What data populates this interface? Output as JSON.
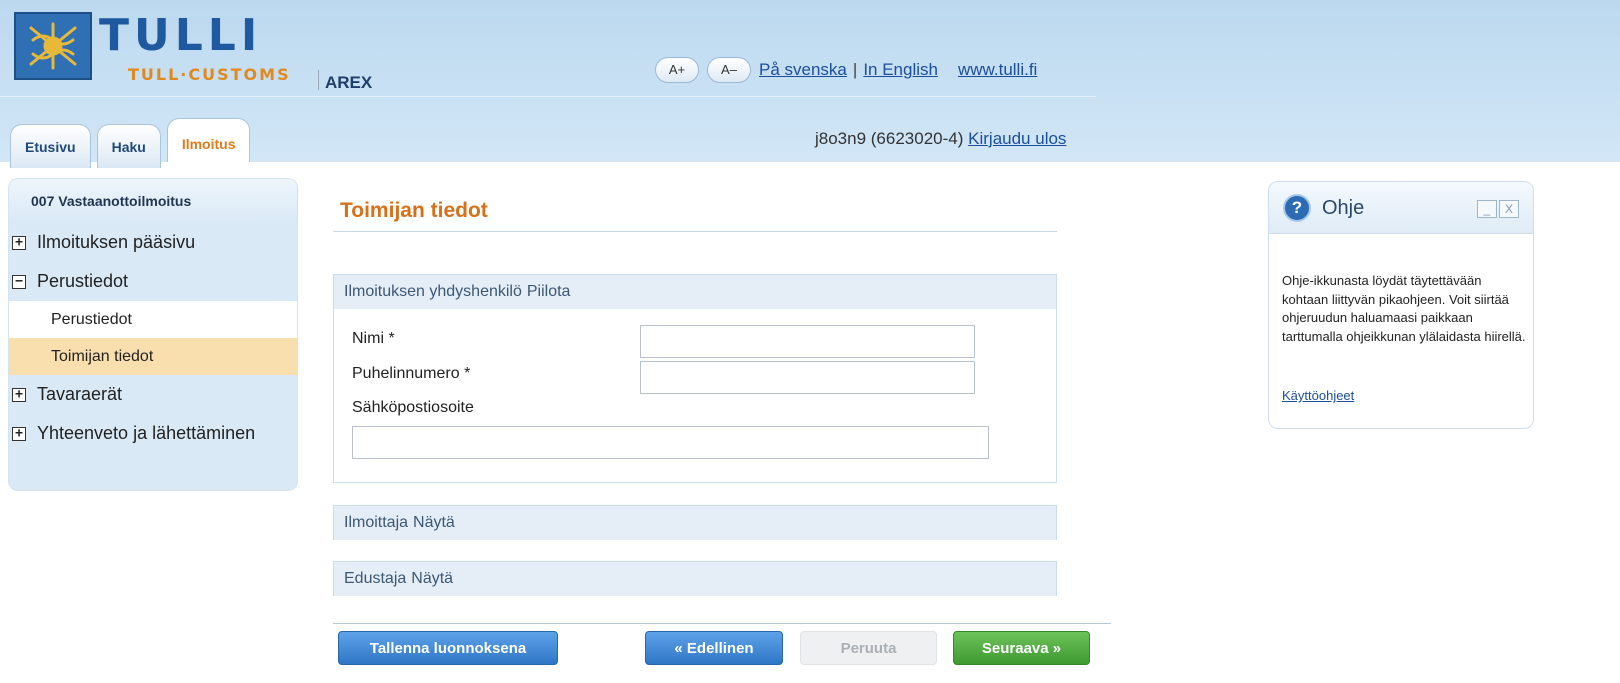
{
  "header": {
    "brand": "TULLI",
    "brand_sub": "TULL·CUSTOMS",
    "app_name": "AREX",
    "font_increase": "A+",
    "font_decrease": "A–",
    "lang_sv": "På svenska",
    "separator": "|",
    "lang_en": "In English",
    "site_link": "www.tulli.fi",
    "user_id": "j8o3n9 (6623020-4)",
    "logout": "Kirjaudu ulos",
    "colors": {
      "brand_blue": "#1f5aa0",
      "brand_orange": "#e08a1e",
      "header_bg": "#c9e1f4"
    }
  },
  "tabs": [
    {
      "label": "Etusivu",
      "active": false
    },
    {
      "label": "Haku",
      "active": false
    },
    {
      "label": "Ilmoitus",
      "active": true
    }
  ],
  "sidebar": {
    "title": "007 Vastaanottoilmoitus",
    "items": [
      {
        "label": "Ilmoituksen pääsivu",
        "expander": "+"
      },
      {
        "label": "Perustiedot",
        "expander": "−"
      },
      {
        "label": "Tavaraerät",
        "expander": "+"
      },
      {
        "label": "Yhteenveto ja lähettäminen",
        "expander": "+"
      }
    ],
    "subitems": [
      {
        "label": "Perustiedot",
        "selected": false
      },
      {
        "label": "Toimijan tiedot",
        "selected": true
      }
    ]
  },
  "main": {
    "section_title": "Toimijan tiedot",
    "contact_panel": {
      "title": "Ilmoituksen yhdyshenkilö",
      "toggle": "Piilota",
      "name_label": "Nimi *",
      "name_value": "",
      "phone_label": "Puhelinnumero *",
      "phone_value": "",
      "email_label": "Sähköpostiosoite",
      "email_value": ""
    },
    "declarant_panel": {
      "title": "Ilmoittaja",
      "toggle": "Näytä"
    },
    "representative_panel": {
      "title": "Edustaja",
      "toggle": "Näytä"
    }
  },
  "buttons": {
    "save_draft": "Tallenna luonnoksena",
    "previous": "« Edellinen",
    "cancel": "Peruuta",
    "next": "Seuraava »"
  },
  "help": {
    "icon": "?",
    "title": "Ohje",
    "text": "Ohje-ikkunasta löydät täytettävään kohtaan liittyvän pikaohjeen. Voit siirtää ohjeruudun haluamaasi paikkaan tarttumalla ohjeikkunan ylälaidasta hiirellä.",
    "link": "Käyttöohjeet",
    "minimize": "_",
    "close": "X"
  }
}
